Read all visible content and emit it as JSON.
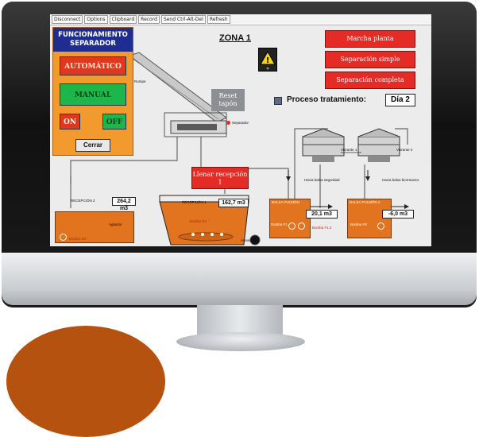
{
  "toolbar": {
    "buttons": [
      "Disconnect",
      "Options",
      "Clipboard",
      "Record",
      "Send Ctrl-Alt-Del",
      "Refresh"
    ]
  },
  "panel": {
    "title": "FUNCIONAMIENTO SEPARADOR",
    "automatico": "AUTOMÁTICO",
    "manual": "MANUAL",
    "on": "ON",
    "off": "OFF",
    "cerrar": "Cerrar"
  },
  "zona": "ZONA 1",
  "actions": {
    "marcha": "Marcha planta",
    "simple": "Separación simple",
    "completa": "Separación completa",
    "reset": "Reset tapón",
    "llenar": "Llenar recepción 1"
  },
  "proceso": {
    "label": "Proceso tratamiento:",
    "value": "Día 2"
  },
  "labels": {
    "rompe": "Rompe",
    "separador": "Separador",
    "vibrante1": "Vibrante 1",
    "vibrante2": "Vibrante 2",
    "hacia_balsa_seguridad": "Hacia balsa seguridad",
    "hacia_balsa_biorreactor": "Hacia balsa biorreactor",
    "recepcion2": "RECEPCIÓN 2",
    "recepcion1": "RECEPCIÓN 1",
    "bomba_r2": "Bomba R2",
    "agitador": "Agitador",
    "bomba_r1": "Bomba R1",
    "aireacion": "Aireación 1",
    "balsa_pulmon1": "BALSA PULMÓN",
    "balsa_pulmon2": "BALSA PULMÓN 2",
    "bomba_p1": "Bomba P1",
    "bomba_p2": "Bomba P2",
    "bomba_f1_2": "Bomba F1.2",
    "bomba_p2b": "Bomba P2"
  },
  "values": {
    "recepcion2": "264,2 m3",
    "recepcion1": "162,7 m3",
    "pulmon1": "20,1 m3",
    "pulmon2": "-6,0 m3"
  },
  "colors": {
    "panel": "#f39a2e",
    "title_bar": "#1e2d8f",
    "red_button": "#e42b26",
    "green_button": "#1db64d",
    "tank": "#e2731f",
    "accent_blob": "#b5520f"
  }
}
